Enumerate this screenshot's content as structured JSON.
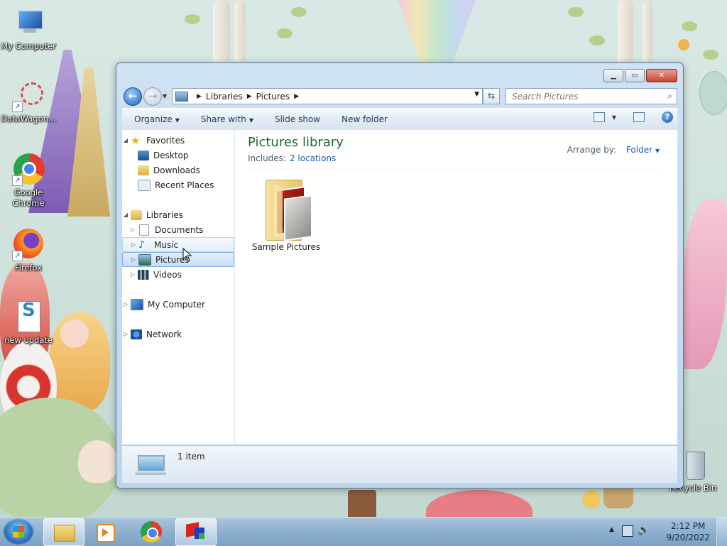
{
  "desktop": {
    "icons": [
      {
        "label": "My Computer"
      },
      {
        "label": "DataWagon..."
      },
      {
        "label": "Google Chrome"
      },
      {
        "label": "Firefox"
      },
      {
        "label": "new update"
      },
      {
        "label": "Recycle Bin"
      }
    ]
  },
  "window": {
    "breadcrumb": [
      "Libraries",
      "Pictures"
    ],
    "search_placeholder": "Search Pictures",
    "toolbar": {
      "organize": "Organize",
      "share_with": "Share with",
      "slide_show": "Slide show",
      "new_folder": "New folder"
    },
    "nav": {
      "favorites": "Favorites",
      "desktop": "Desktop",
      "downloads": "Downloads",
      "recent_places": "Recent Places",
      "libraries": "Libraries",
      "documents": "Documents",
      "music": "Music",
      "pictures": "Pictures",
      "videos": "Videos",
      "my_computer": "My Computer",
      "network": "Network"
    },
    "library": {
      "title": "Pictures library",
      "includes_label": "Includes:",
      "includes_link": "2 locations",
      "arrange_label": "Arrange by:",
      "arrange_value": "Folder"
    },
    "items": [
      {
        "name": "Sample Pictures",
        "icon": "folder-with-photos-icon"
      }
    ],
    "status": {
      "text": "1 item"
    }
  },
  "taskbar": {
    "clock_time": "2:12 PM",
    "clock_date": "9/20/2022",
    "apps": [
      "windows-explorer-icon",
      "media-player-icon",
      "chrome-icon",
      "app-cube-icon"
    ]
  },
  "colors": {
    "title_green": "#1e6b2e",
    "link_blue": "#1e5eb3",
    "selection_blue": "#c6def9"
  }
}
